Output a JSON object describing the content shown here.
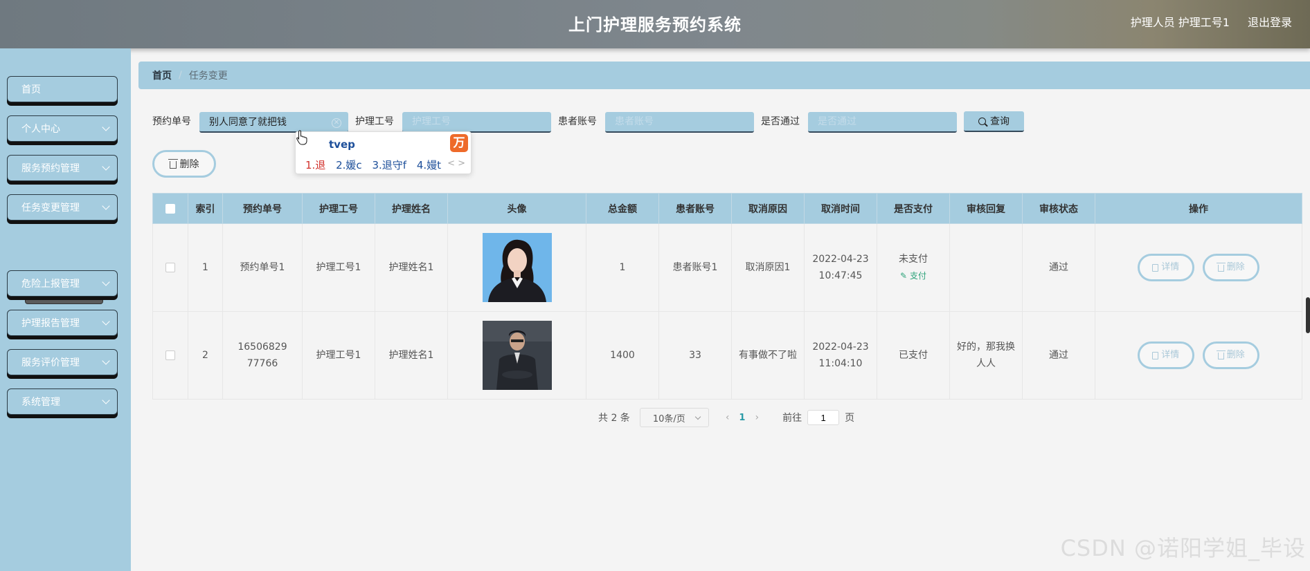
{
  "header": {
    "title": "上门护理服务预约系统",
    "user": "护理人员 护理工号1",
    "logout": "退出登录"
  },
  "sidebar": {
    "items": [
      {
        "label": "首页"
      },
      {
        "label": "个人中心"
      },
      {
        "label": "服务预约管理"
      },
      {
        "label": "任务变更管理"
      },
      {
        "label": "危险上报管理"
      },
      {
        "label": "护理报告管理"
      },
      {
        "label": "服务评价管理"
      },
      {
        "label": "系统管理"
      }
    ],
    "sub_item": "任务变更"
  },
  "breadcrumb": {
    "home": "首页",
    "separator": "/",
    "current": "任务变更"
  },
  "search": {
    "order_label": "预约单号",
    "order_value": "别人同意了就把钱",
    "nurse_label": "护理工号",
    "nurse_placeholder": "护理工号",
    "patient_label": "患者账号",
    "patient_placeholder": "患者账号",
    "pass_label": "是否通过",
    "pass_placeholder": "是否通过",
    "query_label": "查询"
  },
  "ime": {
    "composition": "tvep",
    "logo": "万",
    "candidates": [
      "1.退",
      "2.媛c",
      "3.退守f",
      "4.嫚t"
    ],
    "arrows": "< >"
  },
  "toolbar": {
    "delete_label": "删除"
  },
  "table": {
    "headers": [
      "",
      "索引",
      "预约单号",
      "护理工号",
      "护理姓名",
      "头像",
      "总金额",
      "患者账号",
      "取消原因",
      "取消时间",
      "是否支付",
      "审核回复",
      "审核状态",
      "操作"
    ],
    "rows": [
      {
        "index": "1",
        "order": "预约单号1",
        "nurse_id": "护理工号1",
        "nurse_name": "护理姓名1",
        "amount": "1",
        "patient": "患者账号1",
        "reason": "取消原因1",
        "cancel_time": "2022-04-23 10:47:45",
        "paid": "未支付",
        "pay_link": "支付",
        "reply": "",
        "status": "通过",
        "detail": "详情",
        "delete": "删除"
      },
      {
        "index": "2",
        "order": "1650682977766",
        "nurse_id": "护理工号1",
        "nurse_name": "护理姓名1",
        "amount": "1400",
        "patient": "33",
        "reason": "有事做不了啦",
        "cancel_time": "2022-04-23 11:04:10",
        "paid": "已支付",
        "pay_link": "",
        "reply": "好的，那我换人人",
        "status": "通过",
        "detail": "详情",
        "delete": "删除"
      }
    ]
  },
  "pagination": {
    "total": "共 2 条",
    "page_size": "10条/页",
    "current_page": "1",
    "goto_label": "前往",
    "goto_value": "1",
    "page_suffix": "页"
  },
  "watermark": "CSDN @诺阳学姐_毕设"
}
